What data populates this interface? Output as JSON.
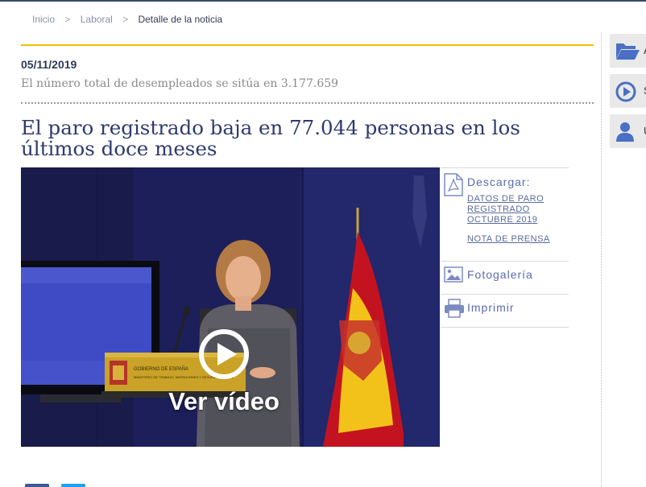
{
  "breadcrumb": {
    "items": [
      "Inicio",
      "Laboral",
      "Detalle de la noticia"
    ],
    "separator": ">"
  },
  "article": {
    "date": "05/11/2019",
    "subtitle": "El número total de desempleados se sitúa en 3.177.659",
    "headline": "El paro registrado baja en 77.044 personas en los últimos doce meses"
  },
  "video": {
    "label": "Ver vídeo",
    "lectern_text_1": "GOBIERNO DE ESPAÑA",
    "lectern_text_2": "MINISTERIO DE TRABAJO, MIGRACIONES Y SEGURIDAD SOCIAL"
  },
  "downloads": {
    "title": "Descargar:",
    "links": [
      "DATOS DE PARO REGISTRADO OCTUBRE 2019",
      "NOTA DE PRENSA"
    ]
  },
  "gallery_label": "Fotogalería",
  "print_label": "Imprimir",
  "quick_access": {
    "items": [
      {
        "label": "A",
        "icon": "folder-open-icon"
      },
      {
        "label": "S",
        "icon": "play-circle-icon"
      },
      {
        "label": "U",
        "icon": "user-icon"
      }
    ]
  },
  "colors": {
    "accent_yellow": "#f2c000",
    "headline_navy": "#2e3a6e",
    "link_blue": "#5a6bb0",
    "panel_gray": "#e9e9e9",
    "share_facebook": "#3b5998",
    "share_twitter": "#1da1f2"
  }
}
